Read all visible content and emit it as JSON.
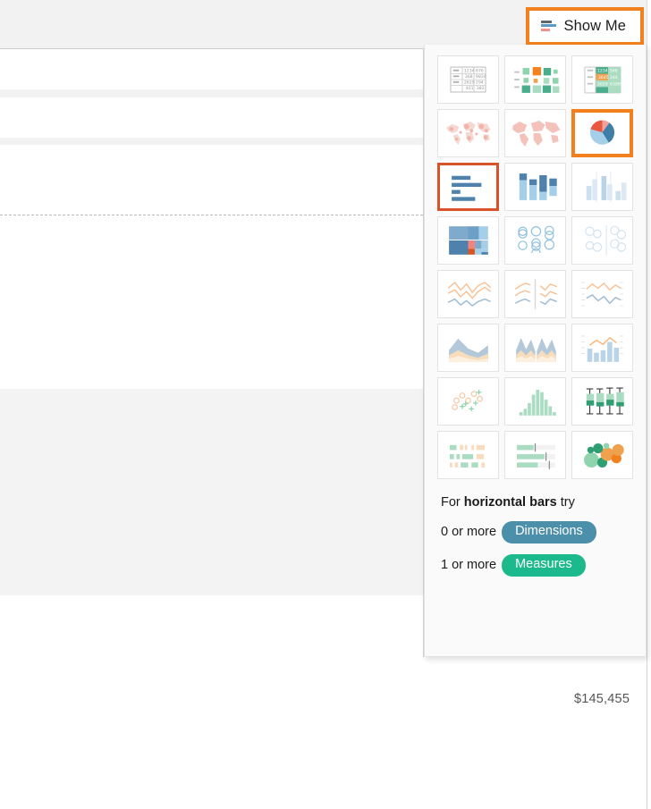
{
  "app": {
    "name": "Tableau worksheet with Show Me panel"
  },
  "toolbar": {
    "show_me_label": "Show Me",
    "show_me_icon": "horizontal-bars-icon",
    "show_me_highlight_color": "#f2811d"
  },
  "panel": {
    "selected_chart": "horizontal-bars",
    "highlighted_chart": "pie-charts",
    "selection_border_color": "#d8532a",
    "highlight_border_color": "#f2811d",
    "thumbnails": [
      {
        "id": "text-tables",
        "label": "Text Tables",
        "state": "normal"
      },
      {
        "id": "heat-maps",
        "label": "Heat Maps",
        "state": "normal"
      },
      {
        "id": "highlight-tables",
        "label": "Highlight Tables",
        "state": "normal"
      },
      {
        "id": "symbol-maps",
        "label": "Symbol Maps",
        "state": "normal"
      },
      {
        "id": "filled-maps",
        "label": "Maps",
        "state": "normal"
      },
      {
        "id": "pie-charts",
        "label": "Pie Charts",
        "state": "highlighted"
      },
      {
        "id": "horizontal-bars",
        "label": "Horizontal Bars",
        "state": "selected"
      },
      {
        "id": "stacked-bars",
        "label": "Stacked Bars",
        "state": "normal"
      },
      {
        "id": "side-by-side-bars",
        "label": "Side-by-Side Bars",
        "state": "disabled"
      },
      {
        "id": "treemaps",
        "label": "Treemaps",
        "state": "normal"
      },
      {
        "id": "circle-views",
        "label": "Circle Views",
        "state": "normal"
      },
      {
        "id": "side-by-side-circles",
        "label": "Side-by-Side Circles",
        "state": "disabled"
      },
      {
        "id": "lines-continuous",
        "label": "Lines (Continuous)",
        "state": "disabled"
      },
      {
        "id": "lines-discrete",
        "label": "Lines (Discrete)",
        "state": "disabled"
      },
      {
        "id": "dual-lines",
        "label": "Dual Lines",
        "state": "disabled"
      },
      {
        "id": "area-continuous",
        "label": "Area Charts (Continuous)",
        "state": "disabled"
      },
      {
        "id": "area-discrete",
        "label": "Area Charts (Discrete)",
        "state": "disabled"
      },
      {
        "id": "dual-combination",
        "label": "Dual Combination",
        "state": "disabled"
      },
      {
        "id": "scatter-plots",
        "label": "Scatter Plots",
        "state": "disabled"
      },
      {
        "id": "histogram",
        "label": "Histogram",
        "state": "disabled"
      },
      {
        "id": "box-and-whisker",
        "label": "Box-and-Whisker Plots",
        "state": "disabled"
      },
      {
        "id": "gantt-charts",
        "label": "Gantt Charts",
        "state": "disabled"
      },
      {
        "id": "bullet-graphs",
        "label": "Bullet Graphs",
        "state": "disabled"
      },
      {
        "id": "packed-bubbles",
        "label": "Packed Bubbles",
        "state": "disabled"
      }
    ],
    "help": {
      "intro_prefix": "For ",
      "intro_bold": "horizontal bars",
      "intro_suffix": " try",
      "requirements": [
        {
          "qty": "0 or more",
          "pill": "Dimensions",
          "pill_color": "#4b8fab"
        },
        {
          "qty": "1 or more",
          "pill": "Measures",
          "pill_color": "#1cb98c"
        }
      ]
    }
  },
  "worksheet": {
    "value_label": "$145,455"
  },
  "chart_data": {
    "type": "bar",
    "title": "",
    "categories": [
      ""
    ],
    "values": [
      145455
    ],
    "data_labels": [
      "$145,455"
    ],
    "xlabel": "",
    "ylabel": "",
    "orientation": "horizontal"
  }
}
